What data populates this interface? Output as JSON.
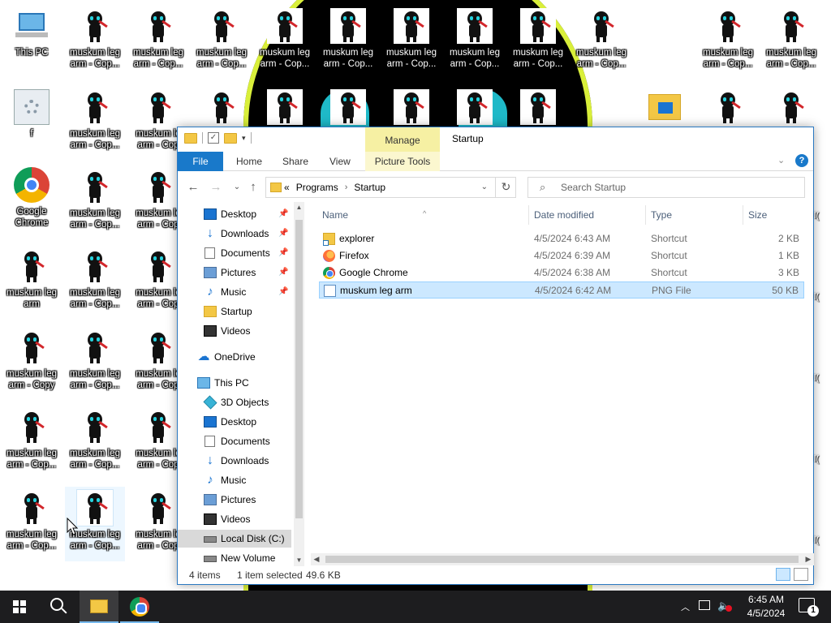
{
  "desktop": {
    "icons": {
      "this_pc": "This PC",
      "f_icon": "f",
      "google_chrome": "Google Chrome",
      "muskum_copy": "muskum leg arm - Cop...",
      "muskum_plain": "muskum leg arm",
      "muskum_copy_full": "muskum leg arm - Copy",
      "muskum_trunc": "muskum le arm - Cop"
    }
  },
  "window": {
    "title": "Startup",
    "manage_tab": "Manage",
    "ribbon_tabs": [
      "File",
      "Home",
      "Share",
      "View",
      "Picture Tools"
    ],
    "address": {
      "overflow": "«",
      "crumbs": [
        "Programs",
        "Startup"
      ]
    },
    "search_placeholder": "Search Startup",
    "nav_pane": {
      "quick_access": [
        "Desktop",
        "Downloads",
        "Documents",
        "Pictures",
        "Music",
        "Startup",
        "Videos"
      ],
      "onedrive": "OneDrive",
      "this_pc": "This PC",
      "pc_items": [
        "3D Objects",
        "Desktop",
        "Documents",
        "Downloads",
        "Music",
        "Pictures",
        "Videos",
        "Local Disk (C:)",
        "New Volume (E:)"
      ]
    },
    "columns": [
      "Name",
      "Date modified",
      "Type",
      "Size"
    ],
    "files": [
      {
        "name": "explorer",
        "date": "4/5/2024 6:43 AM",
        "type": "Shortcut",
        "size": "2 KB",
        "icon": "folder-shortcut-icon"
      },
      {
        "name": "Firefox",
        "date": "4/5/2024 6:39 AM",
        "type": "Shortcut",
        "size": "1 KB",
        "icon": "firefox-icon"
      },
      {
        "name": "Google Chrome",
        "date": "4/5/2024 6:38 AM",
        "type": "Shortcut",
        "size": "3 KB",
        "icon": "chrome-icon"
      },
      {
        "name": "muskum leg arm",
        "date": "4/5/2024 6:42 AM",
        "type": "PNG File",
        "size": "50 KB",
        "icon": "png-file-icon",
        "selected": true
      }
    ],
    "status": {
      "item_count": "4 items",
      "selected": "1 item selected",
      "selected_size": "49.6 KB"
    }
  },
  "taskbar": {
    "time": "6:45 AM",
    "date": "4/5/2024",
    "notification_count": "1"
  },
  "colors": {
    "accent": "#1979ca",
    "manage_tab": "#f6f0a3",
    "selection": "#cce8ff",
    "taskbar": "#1d1d1f"
  }
}
